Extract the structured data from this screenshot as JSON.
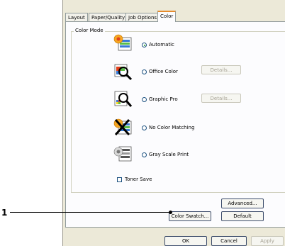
{
  "tabs": [
    {
      "label": "Layout",
      "active": false
    },
    {
      "label": "Paper/Quality",
      "active": false
    },
    {
      "label": "Job Options",
      "active": false
    },
    {
      "label": "Color",
      "active": true
    }
  ],
  "color_mode": {
    "label": "Color Mode",
    "options": [
      {
        "label": "Automatic",
        "selected": true,
        "icon": "automatic-color-icon"
      },
      {
        "label": "Office Color",
        "selected": false,
        "icon": "office-color-icon",
        "details": "Details..."
      },
      {
        "label": "Graphic Pro",
        "selected": false,
        "icon": "graphic-pro-icon",
        "details": "Details..."
      },
      {
        "label": "No Color Matching",
        "selected": false,
        "icon": "no-color-matching-icon"
      },
      {
        "label": "Gray Scale Print",
        "selected": false,
        "icon": "gray-scale-print-icon"
      }
    ]
  },
  "toner_save": {
    "label": "Toner Save",
    "checked": false
  },
  "buttons": {
    "advanced": "Advanced...",
    "color_swatch": "Color Swatch...",
    "default": "Default",
    "ok": "OK",
    "cancel": "Cancel",
    "apply": "Apply"
  },
  "callout": {
    "number": "1"
  },
  "colors": {
    "dialog_bg": "#ece9d8",
    "panel_bg": "#fcfcfe",
    "tab_highlight": "#e68b2c"
  }
}
